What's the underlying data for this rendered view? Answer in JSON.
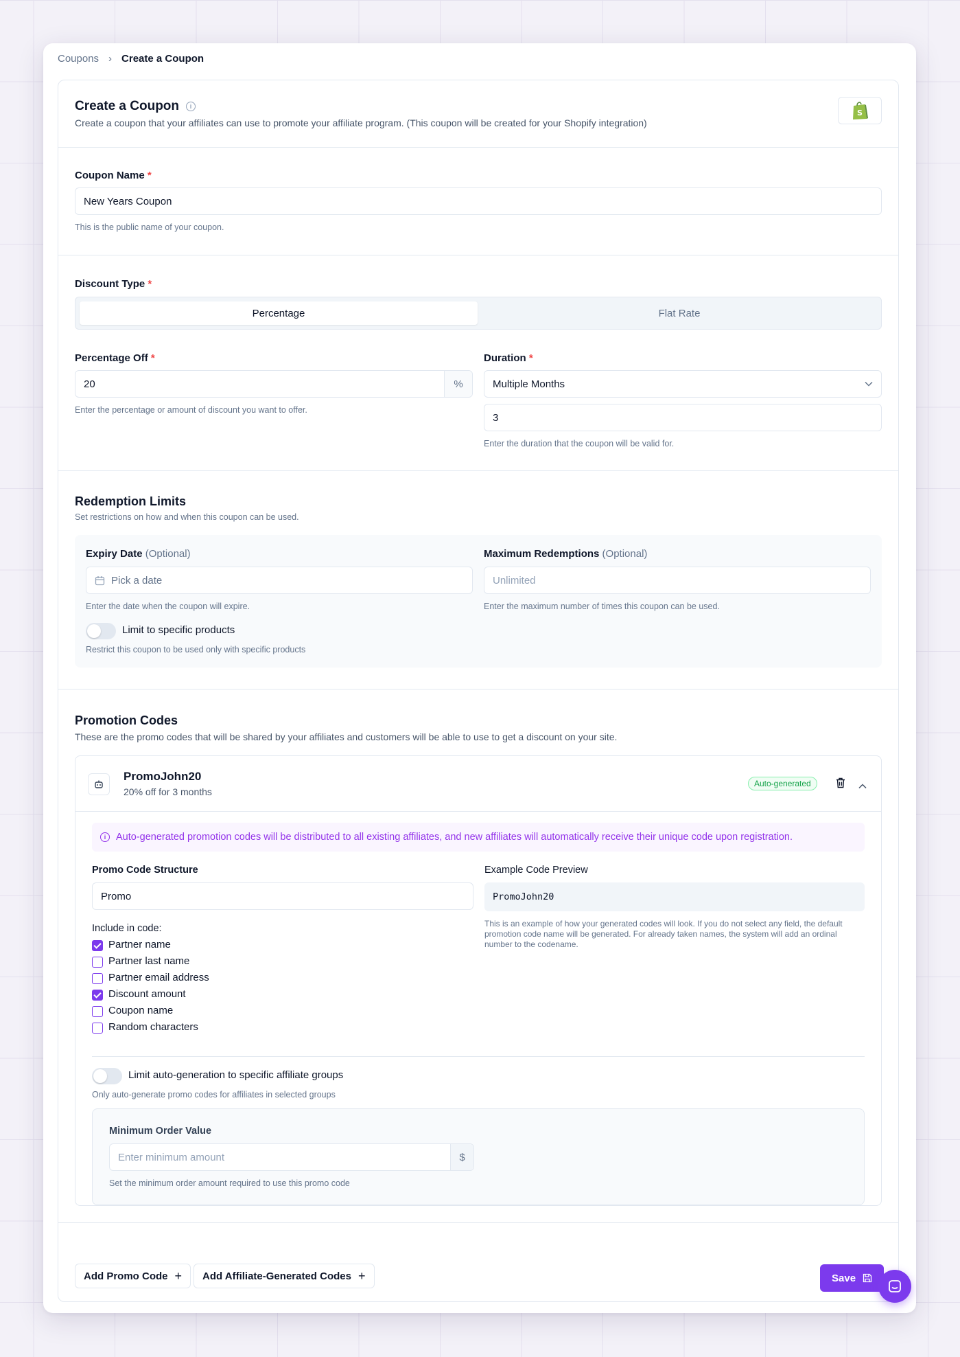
{
  "breadcrumb": {
    "parent": "Coupons",
    "current": "Create a Coupon"
  },
  "header": {
    "title": "Create a Coupon",
    "description": "Create a coupon that your affiliates can use to promote your affiliate program. (This coupon will be created for your Shopify integration)"
  },
  "coupon_name": {
    "label": "Coupon Name",
    "required": "*",
    "value": "New Years Coupon",
    "help": "This is the public name of your coupon."
  },
  "discount_type": {
    "label": "Discount Type",
    "required": "*",
    "options": [
      "Percentage",
      "Flat Rate"
    ],
    "selected": "Percentage"
  },
  "percentage_off": {
    "label": "Percentage Off",
    "required": "*",
    "value": "20",
    "suffix": "%",
    "help": "Enter the percentage or amount of discount you want to offer."
  },
  "duration": {
    "label": "Duration",
    "required": "*",
    "selected": "Multiple Months",
    "months": "3",
    "help": "Enter the duration that the coupon will be valid for."
  },
  "redemption": {
    "title": "Redemption Limits",
    "subtitle": "Set restrictions on how and when this coupon can be used.",
    "expiry_label": "Expiry Date",
    "expiry_optional": "(Optional)",
    "expiry_placeholder": "Pick a date",
    "expiry_help": "Enter the date when the coupon will expire.",
    "max_label": "Maximum Redemptions",
    "max_optional": "(Optional)",
    "max_placeholder": "Unlimited",
    "max_help": "Enter the maximum number of times this coupon can be used.",
    "limit_products_label": "Limit to specific products",
    "limit_products_help": "Restrict this coupon to be used only with specific products"
  },
  "promotion": {
    "title": "Promotion Codes",
    "subtitle": "These are the promo codes that will be shared by your affiliates and customers will be able to use to get a discount on your site.",
    "code": {
      "name": "PromoJohn20",
      "summary": "20% off for 3 months",
      "badge": "Auto-generated",
      "notice": "Auto-generated promotion codes will be distributed to all existing affiliates, and new affiliates will automatically receive their unique code upon registration.",
      "structure_label": "Promo Code Structure",
      "structure_value": "Promo",
      "include_label": "Include in code:",
      "include_options": [
        {
          "label": "Partner name",
          "checked": true
        },
        {
          "label": "Partner last name",
          "checked": false
        },
        {
          "label": "Partner email address",
          "checked": false
        },
        {
          "label": "Discount amount",
          "checked": true
        },
        {
          "label": "Coupon name",
          "checked": false
        },
        {
          "label": "Random characters",
          "checked": false
        }
      ],
      "preview_label": "Example Code Preview",
      "preview_value": "PromoJohn20",
      "preview_help": "This is an example of how your generated codes will look. If you do not select any field, the default promotion code name will be generated. For already taken names, the system will add an ordinal number to the codename.",
      "limit_groups_label": "Limit auto-generation to specific affiliate groups",
      "limit_groups_help": "Only auto-generate promo codes for affiliates in selected groups",
      "min_order_label": "Minimum Order Value",
      "min_order_placeholder": "Enter minimum amount",
      "min_order_suffix": "$",
      "min_order_help": "Set the minimum order amount required to use this promo code"
    }
  },
  "footer": {
    "add_promo": "Add Promo Code",
    "add_affiliate": "Add Affiliate-Generated Codes",
    "save": "Save"
  },
  "colors": {
    "accent": "#7c3aed",
    "shopify": "#95bf47",
    "badge_green": "#16a34a"
  },
  "icons": [
    "chevron-right-icon",
    "info-icon",
    "shopify-icon",
    "chevron-down-icon",
    "calendar-icon",
    "robot-icon",
    "trash-icon",
    "chevron-up-icon",
    "plus-icon",
    "save-icon",
    "chat-icon"
  ]
}
